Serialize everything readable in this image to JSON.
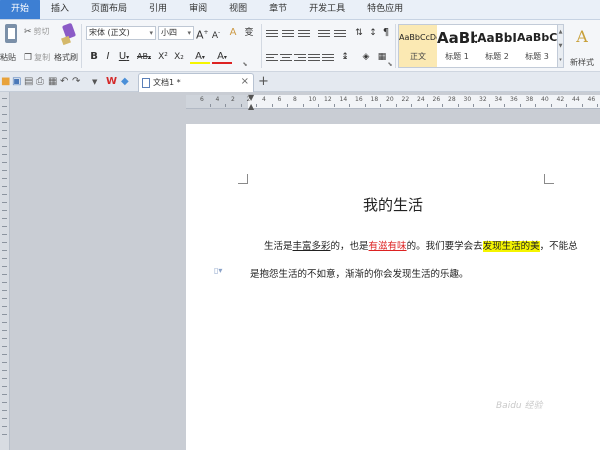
{
  "menu": {
    "tabs": [
      {
        "label": "开始"
      },
      {
        "label": "插入"
      },
      {
        "label": "页面布局"
      },
      {
        "label": "引用"
      },
      {
        "label": "审阅"
      },
      {
        "label": "视图"
      },
      {
        "label": "章节"
      },
      {
        "label": "开发工具"
      },
      {
        "label": "特色应用"
      }
    ]
  },
  "ribbon": {
    "paste_label": "粘贴",
    "cut_label": "剪切",
    "copy_label": "复制",
    "format_painter_label": "格式刷",
    "font_name": "宋体 (正文)",
    "font_size": "小四",
    "grow_font": "A",
    "shrink_font": "A",
    "bold": "B",
    "italic": "I",
    "underline": "U",
    "strikethrough": "AB",
    "superscript": "X²",
    "subscript": "X₂",
    "highlight": "A",
    "font_color": "A",
    "clear_format": "A",
    "phonetic": "变",
    "styles": [
      {
        "sample": "AaBbCcDd",
        "name": "正文"
      },
      {
        "sample": "AaBb",
        "name": "标题 1"
      },
      {
        "sample": "AaBbI",
        "name": "标题 2"
      },
      {
        "sample": "AaBbC",
        "name": "标题 3"
      }
    ],
    "new_style_label": "新样式",
    "new_style_glyph": "A"
  },
  "tabbar": {
    "doc_tab_name": "文档1 *",
    "close_glyph": "×",
    "add_glyph": "+"
  },
  "ruler": {
    "numbers": [
      "6",
      "4",
      "2",
      "2",
      "4",
      "6",
      "8",
      "10",
      "12",
      "14",
      "16",
      "18",
      "20",
      "22",
      "24",
      "26",
      "28",
      "30",
      "32",
      "34",
      "36",
      "38",
      "40",
      "42",
      "44",
      "46"
    ]
  },
  "document": {
    "title": "我的生活",
    "line1": {
      "p1": "生活是",
      "u1": "丰富多彩",
      "p2": "的，也是",
      "u2": "有滋有味",
      "p3": "的。我们要学会去",
      "hl": "发现生活的美",
      "p4": "，不能总"
    },
    "line2": "是抱怨生活的不如意，渐渐的你会发现生活的乐趣。"
  },
  "watermark": "Baidu 经验",
  "colors": {
    "accent": "#3d7fd3",
    "highlight": "#f5f500",
    "red_text": "#dd2222"
  }
}
